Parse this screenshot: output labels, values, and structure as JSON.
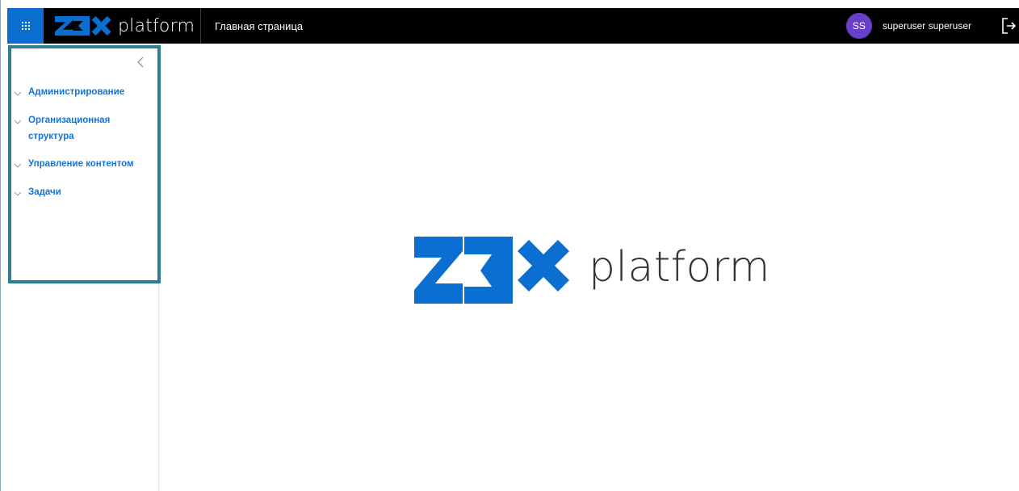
{
  "header": {
    "brand_text": "platform",
    "page_title": "Главная страница",
    "avatar_initials": "SS",
    "username": "superuser superuser",
    "brand_color": "#0a6fd1",
    "avatar_color": "#6a3fc8"
  },
  "sidebar": {
    "accent_color": "#1473d6",
    "items": [
      {
        "label": "Администрирование",
        "icon": "chevron-down-icon"
      },
      {
        "label": "Организационная структура",
        "icon": "chevron-down-icon"
      },
      {
        "label": "Управление контентом",
        "icon": "chevron-down-icon"
      },
      {
        "label": "Задачи",
        "icon": "chevron-down-icon"
      }
    ]
  },
  "main": {
    "logo_text": "platform"
  }
}
